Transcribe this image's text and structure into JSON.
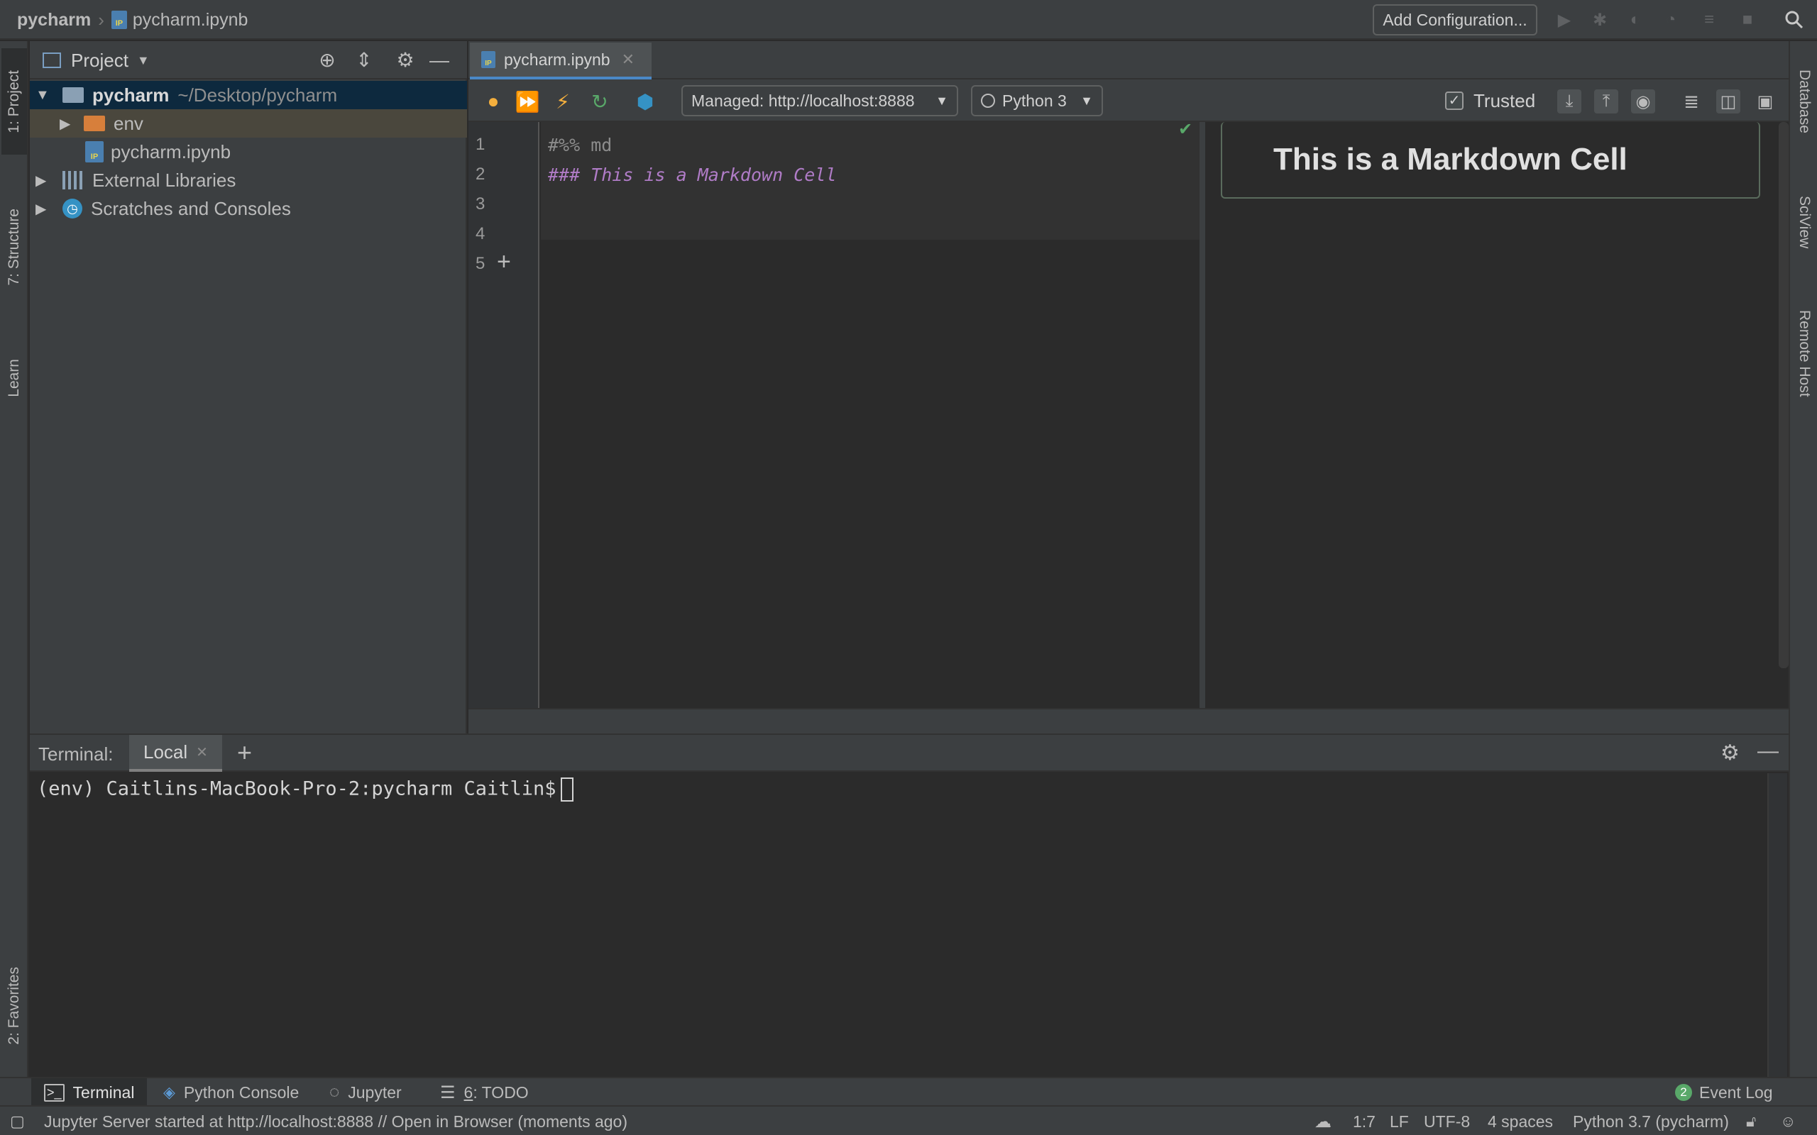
{
  "navbar": {
    "project": "pycharm",
    "file": "pycharm.ipynb",
    "add_configuration": "Add Configuration..."
  },
  "left_stripe": {
    "project_tab": "1: Project",
    "structure_tab": "7: Structure",
    "learn_tab": "Learn",
    "favorites_tab": "2: Favorites"
  },
  "right_stripe": {
    "database_tab": "Database",
    "sciview_tab": "SciView",
    "remote_host_tab": "Remote Host"
  },
  "project_panel": {
    "title": "Project",
    "tree": [
      {
        "label": "pycharm",
        "path": "~/Desktop/pycharm"
      },
      {
        "label": "env"
      },
      {
        "label": "pycharm.ipynb"
      },
      {
        "label": "External Libraries"
      },
      {
        "label": "Scratches and Consoles"
      }
    ]
  },
  "editor": {
    "tab_label": "pycharm.ipynb",
    "server": "Managed: http://localhost:8888",
    "kernel": "Python 3",
    "trusted_label": "Trusted",
    "trusted_checked": true,
    "line_numbers": [
      "1",
      "2",
      "3",
      "4",
      "5"
    ],
    "code": [
      "#%% md",
      "### This is a Markdown Cell"
    ],
    "preview_heading": "This is a Markdown Cell"
  },
  "terminal": {
    "title": "Terminal:",
    "tab": "Local",
    "prompt": "(env) Caitlins-MacBook-Pro-2:pycharm Caitlin$"
  },
  "tool_tabs": {
    "terminal": "Terminal",
    "python_console": "Python Console",
    "jupyter": "Jupyter",
    "todo_num": "6",
    "todo": ": TODO",
    "event_log_count": "2",
    "event_log": "Event Log"
  },
  "status": {
    "message": "Jupyter Server started at http://localhost:8888 // Open in Browser (moments ago)",
    "position": "1:7",
    "line_sep": "LF",
    "encoding": "UTF-8",
    "indent": "4 spaces",
    "interpreter": "Python 3.7 (pycharm)"
  },
  "colors": {
    "accent": "#4a88c7",
    "run_green": "#59a869",
    "lightning": "#f4af3d",
    "markdown_code": "#b07cc7",
    "selection": "#0d293e"
  }
}
